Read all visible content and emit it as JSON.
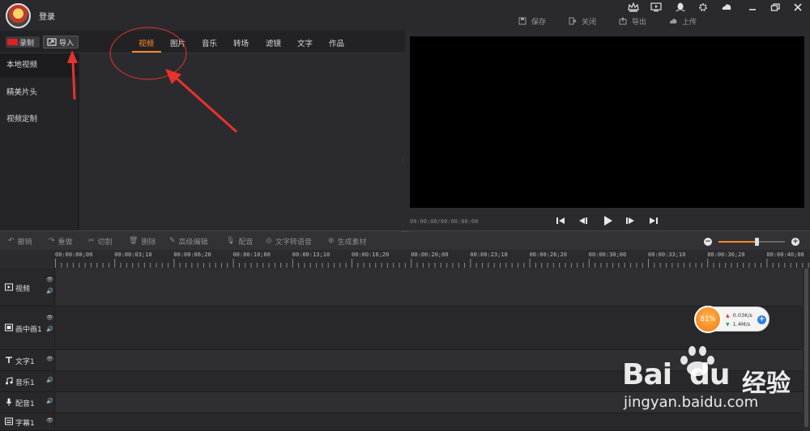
{
  "topbar": {
    "login_label": "登录",
    "system_icons": [
      "vip-crown-icon",
      "tv-icon",
      "qq-penguin-icon",
      "gear-icon",
      "cloud-icon",
      "minimize-icon",
      "restore-icon",
      "close-icon"
    ],
    "file_actions": [
      {
        "label": "保存",
        "icon": "save-icon"
      },
      {
        "label": "关闭",
        "icon": "exit-icon"
      },
      {
        "label": "导出",
        "icon": "export-icon"
      },
      {
        "label": "上传",
        "icon": "upload-icon"
      }
    ]
  },
  "media": {
    "record_label": "录制",
    "import_label": "导入",
    "tabs": [
      {
        "label": "视频",
        "active": true
      },
      {
        "label": "图片"
      },
      {
        "label": "音乐"
      },
      {
        "label": "转场"
      },
      {
        "label": "滤镜"
      },
      {
        "label": "文字"
      },
      {
        "label": "作品"
      }
    ],
    "side_items": [
      {
        "label": "本地视频",
        "active": true
      },
      {
        "label": "精美片头"
      },
      {
        "label": "视频定制"
      }
    ]
  },
  "preview": {
    "time_readout": "00:00:00/00:00:00:00",
    "controls": [
      "skip-start-icon",
      "step-back-icon",
      "play-icon",
      "step-forward-icon",
      "skip-end-icon"
    ]
  },
  "edit_toolbar": {
    "buttons": [
      {
        "label": "撤销",
        "icon": "undo-icon"
      },
      {
        "label": "重做",
        "icon": "redo-icon"
      },
      {
        "label": "切割",
        "icon": "scissors-icon"
      },
      {
        "label": "删除",
        "icon": "trash-icon"
      },
      {
        "label": "高级编辑",
        "icon": "pencil-icon"
      },
      {
        "label": "配音",
        "icon": "microphone-icon"
      },
      {
        "label": "文字转语音",
        "icon": "text-to-speech-icon"
      },
      {
        "label": "生成素材",
        "icon": "generate-icon"
      }
    ],
    "zoom_level": 0.57
  },
  "timeline": {
    "ruler_labels": [
      "00:00:00;00",
      "00:00:03;10",
      "00:00:06;20",
      "00:00:10;00",
      "00:00:13;10",
      "00:00:16;20",
      "00:00:20;00",
      "00:00:23;10",
      "00:00:26;20",
      "00:00:30;00",
      "00:00:33;10",
      "00:00:36;20",
      "00:00:40;00"
    ],
    "tracks": [
      {
        "label": "视频",
        "icon": "video-track-icon",
        "eye": true,
        "volume": true
      },
      {
        "label": "画中画1",
        "icon": "pip-track-icon",
        "eye": true,
        "volume": true
      },
      {
        "label": "文字1",
        "icon": "text-track-icon",
        "eye": true,
        "volume": false
      },
      {
        "label": "音乐1",
        "icon": "music-track-icon",
        "eye": false,
        "volume": true
      },
      {
        "label": "配音1",
        "icon": "mic-track-icon",
        "eye": false,
        "volume": true
      },
      {
        "label": "字幕1",
        "icon": "subtitle-track-icon",
        "eye": true,
        "volume": false
      }
    ]
  },
  "net_widget": {
    "percent": "81%",
    "up_rate": "0.03K/s",
    "down_rate": "1.4M/s"
  },
  "watermark": {
    "brand_left": "Bai",
    "brand_right": "du",
    "brand_cn": "经验",
    "url": "jingyan.baidu.com"
  },
  "colors": {
    "accent": "#ff8a2b",
    "annotation_red": "#e8322c",
    "record_red": "#e02020"
  }
}
